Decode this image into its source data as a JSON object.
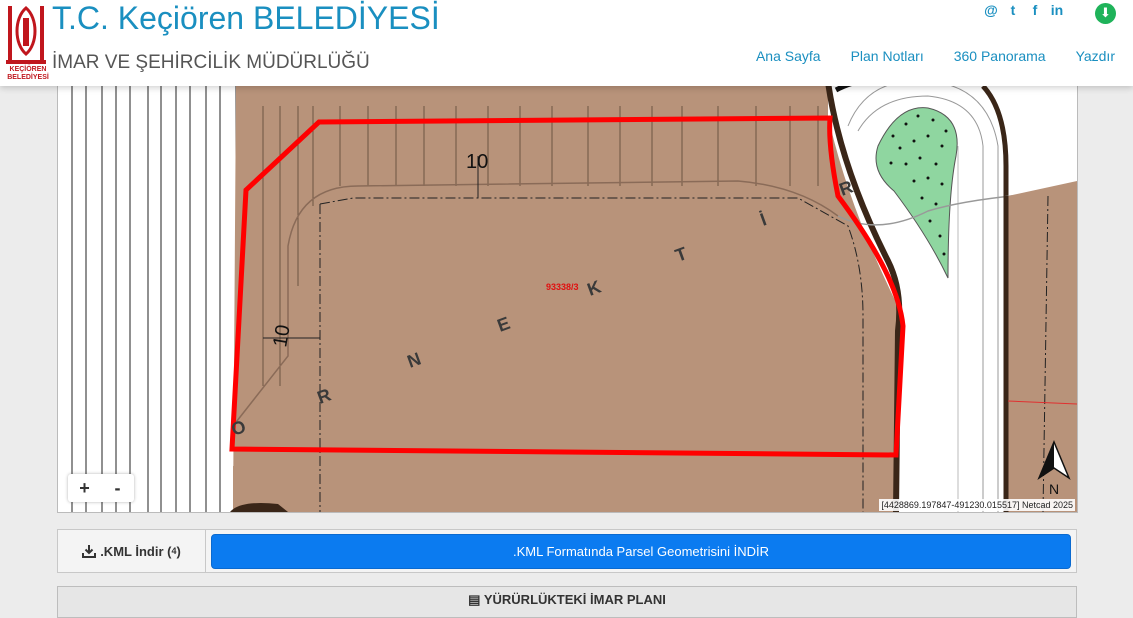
{
  "header": {
    "logo_text_line1": "KEÇİÖREN",
    "logo_text_line2": "BELEDİYESİ",
    "title": "T.C. Keçiören BELEDİYESİ",
    "subtitle": "İMAR VE ŞEHİRCİLİK MÜDÜRLÜĞÜ",
    "social": [
      "@",
      "t",
      "f",
      "in"
    ],
    "download_icon": "download-icon",
    "nav": [
      "Ana Sayfa",
      "Plan Notları",
      "360 Panorama",
      "Yazdır"
    ]
  },
  "map": {
    "dim_label_top": "10",
    "dim_label_left": "10",
    "parcel_label": "93338/3",
    "street_letters": [
      "O",
      "R",
      "N",
      "E",
      "K",
      "T",
      "İ",
      "R"
    ],
    "zoom_in": "+",
    "zoom_out": "-",
    "north_label": "N",
    "coordinates": "[4428869.197847-491230.015517] Netcad 2025",
    "colors": {
      "parcel_fill": "#b8937a",
      "parcel_border": "#ff0000",
      "green_area": "#8fd6a0",
      "road_edge": "#5a3a28"
    }
  },
  "kml": {
    "label": ".KML İndir (",
    "label_sup": "4",
    "label_end": ")",
    "button": ".KML Formatında Parsel Geometrisini İNDİR"
  },
  "plan": {
    "header": "YÜRÜRLÜKTEKİ İMAR PLANI"
  }
}
